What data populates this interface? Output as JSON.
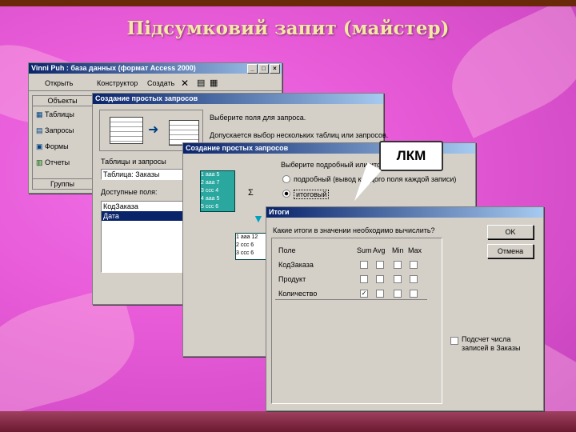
{
  "slide": {
    "title": "Підсумковий запит (майстер)",
    "callout": "ЛКМ"
  },
  "main_window": {
    "title": "Vinni Puh : база данных (формат Access 2000)",
    "toolbar": {
      "open": "Открыть",
      "design": "Конструктор",
      "create": "Создать"
    },
    "sidebar": {
      "header": "Объекты",
      "items": [
        "Таблицы",
        "Запросы",
        "Формы",
        "Отчеты"
      ],
      "footer": "Группы"
    }
  },
  "wizard1": {
    "title": "Создание простых запросов",
    "choose_fields": "Выберите поля для запроса.",
    "multi_tables": "Допускается выбор нескольких таблиц или запросов.",
    "tables_label": "Таблицы и запросы",
    "tables_value": "Таблица: Заказы",
    "available_label": "Доступные поля:",
    "available_fields": [
      "КодЗаказа",
      "Дата"
    ]
  },
  "wizard2": {
    "title": "Создание простых запросов",
    "question": "Выберите подробный или итоговый отчет:",
    "option_detail": "подробный (вывод каждого поля каждой записи)",
    "option_summary": "итоговый",
    "diagram_rows_a": [
      "1 ааа 5",
      "2 ааа 7",
      "3 ссс 4",
      "4 ааа 5",
      "5 ссс 6"
    ],
    "diagram_rows_b": [
      "1 ааа 12",
      "2 ссс 6",
      "3 ссс 6"
    ],
    "sigma": "Σ"
  },
  "totals_dialog": {
    "title": "Итоги",
    "question": "Какие итоги в значении необходимо вычислить?",
    "ok": "OK",
    "cancel": "Отмена",
    "columns": [
      "Поле",
      "Sum",
      "Avg",
      "Min",
      "Max"
    ],
    "rows": [
      {
        "field": "КодЗаказа",
        "checked": [
          false,
          false,
          false,
          false
        ]
      },
      {
        "field": "Продукт",
        "checked": [
          false,
          false,
          false,
          false
        ]
      },
      {
        "field": "Количество",
        "checked": [
          true,
          false,
          false,
          false
        ]
      }
    ],
    "count_label": "Подсчет числа записей в Заказы"
  },
  "colors": {
    "titlebar": "#0a246a",
    "title_text": "#f4e8a6",
    "background": "#e85bd8"
  }
}
